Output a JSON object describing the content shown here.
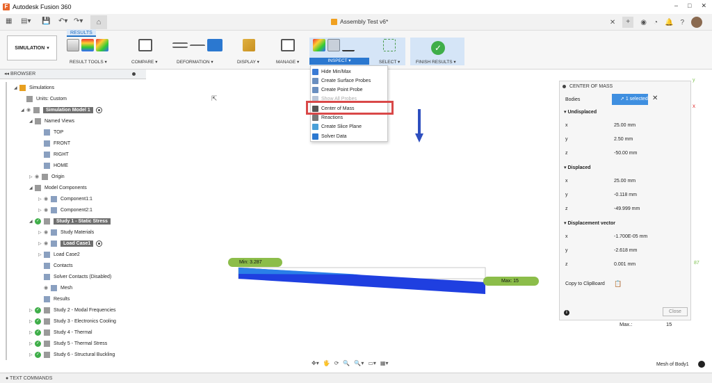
{
  "app": {
    "title": "Autodesk Fusion 360",
    "logo_letter": "F",
    "document_title": "Assembly Test v6*",
    "win_controls": [
      "–",
      "□",
      "✕"
    ]
  },
  "quick_access": {
    "grid_icon": "▦",
    "file_icon": "▤▾",
    "save_icon": "💾",
    "undo_icon": "↶▾",
    "redo_icon": "↷▾",
    "home_icon": "⌂",
    "doc_close": "✕",
    "new_tab": "+",
    "right_icons": [
      "◉",
      "◔",
      "🔔",
      "?"
    ]
  },
  "ribbon": {
    "active_tab": "RESULTS",
    "workspace": "SIMULATION",
    "groups": {
      "result_tools": "RESULT TOOLS ▾",
      "compare": "COMPARE ▾",
      "deformation": "DEFORMATION ▾",
      "display": "DISPLAY ▾",
      "manage": "MANAGE ▾",
      "inspect": "INSPECT ▾",
      "select": "SELECT ▾",
      "finish": "FINISH RESULTS ▾"
    },
    "finish_check": "✓"
  },
  "inspect_menu": [
    {
      "label": "Hide Min/Max",
      "enabled": true,
      "icon": "minmax-icon",
      "color": "#3a7bd5"
    },
    {
      "label": "Create Surface Probes",
      "enabled": true,
      "icon": "surface-probe-icon",
      "color": "#6a8fc0"
    },
    {
      "label": "Create Point Probe",
      "enabled": true,
      "icon": "point-probe-icon",
      "color": "#6a8fc0"
    },
    {
      "label": "Show All Probes",
      "enabled": false,
      "icon": "probes-icon",
      "color": "#b9c6d8"
    },
    {
      "label": "Center of Mass",
      "enabled": true,
      "icon": "center-of-mass-icon",
      "color": "#555555"
    },
    {
      "label": "Reactions",
      "enabled": true,
      "icon": "reactions-icon",
      "color": "#777777"
    },
    {
      "label": "Create Slice Plane",
      "enabled": true,
      "icon": "slice-plane-icon",
      "color": "#4aa0d8"
    },
    {
      "label": "Solver Data",
      "enabled": true,
      "icon": "info-icon",
      "color": "#2b78d0"
    }
  ],
  "browser": {
    "title": "BROWSER",
    "collapse": "◂◂",
    "items": [
      {
        "label": "Simulations",
        "depth": 0,
        "arrow": "◢",
        "name": "tree-simulations"
      },
      {
        "label": "Units: Custom",
        "depth": 1,
        "arrow": "",
        "name": "tree-units"
      },
      {
        "label": "Simulation Model 1",
        "depth": 1,
        "arrow": "◢",
        "name": "tree-simulation-model",
        "highlight": true,
        "target": true,
        "eye": true
      },
      {
        "label": "Named Views",
        "depth": 2,
        "arrow": "◢",
        "name": "tree-named-views"
      },
      {
        "label": "TOP",
        "depth": 3,
        "arrow": "",
        "name": "tree-view-top"
      },
      {
        "label": "FRONT",
        "depth": 3,
        "arrow": "",
        "name": "tree-view-front"
      },
      {
        "label": "RIGHT",
        "depth": 3,
        "arrow": "",
        "name": "tree-view-right"
      },
      {
        "label": "HOME",
        "depth": 3,
        "arrow": "",
        "name": "tree-view-home"
      },
      {
        "label": "Origin",
        "depth": 2,
        "arrow": "▷",
        "name": "tree-origin",
        "eye": true
      },
      {
        "label": "Model Components",
        "depth": 2,
        "arrow": "◢",
        "name": "tree-model-components"
      },
      {
        "label": "Component1:1",
        "depth": 3,
        "arrow": "▷",
        "name": "tree-component1",
        "eye": true
      },
      {
        "label": "Component2:1",
        "depth": 3,
        "arrow": "▷",
        "name": "tree-component2",
        "eye": true
      },
      {
        "label": "Study 1 - Static Stress",
        "depth": 2,
        "arrow": "◢",
        "name": "tree-study1",
        "highlight": true,
        "check": true
      },
      {
        "label": "Study Materials",
        "depth": 3,
        "arrow": "▷",
        "name": "tree-study-materials",
        "eye": true
      },
      {
        "label": "Load Case1",
        "depth": 3,
        "arrow": "▷",
        "name": "tree-load-case1",
        "highlight": true,
        "target": true,
        "eye": true
      },
      {
        "label": "Load Case2",
        "depth": 3,
        "arrow": "▷",
        "name": "tree-load-case2"
      },
      {
        "label": "Contacts",
        "depth": 3,
        "arrow": "",
        "name": "tree-contacts"
      },
      {
        "label": "Solver Contacts (Disabled)",
        "depth": 3,
        "arrow": "",
        "name": "tree-solver-contacts"
      },
      {
        "label": "Mesh",
        "depth": 3,
        "arrow": "",
        "name": "tree-mesh",
        "eye": true
      },
      {
        "label": "Results",
        "depth": 3,
        "arrow": "",
        "name": "tree-results"
      },
      {
        "label": "Study 2 - Modal Frequencies",
        "depth": 2,
        "arrow": "▷",
        "name": "tree-study2",
        "check": true
      },
      {
        "label": "Study 3 - Electronics Cooling",
        "depth": 2,
        "arrow": "▷",
        "name": "tree-study3",
        "check": true
      },
      {
        "label": "Study 4 - Thermal",
        "depth": 2,
        "arrow": "▷",
        "name": "tree-study4",
        "check": true
      },
      {
        "label": "Study 5 - Thermal Stress",
        "depth": 2,
        "arrow": "▷",
        "name": "tree-study5",
        "check": true
      },
      {
        "label": "Study 6 - Structural Buckling",
        "depth": 2,
        "arrow": "▷",
        "name": "tree-study6",
        "check": true
      }
    ]
  },
  "viewport": {
    "min_label": "Min: 3.287",
    "max_label": "Max: 15",
    "max_caption": "Max.:",
    "max_value": "15",
    "mesh_label": "Mesh of Body1",
    "axis_x": "x",
    "axis_y": "y",
    "axis_tick": "87",
    "nav_icons": [
      "✥▾",
      "🖐",
      "⟳",
      "🔍",
      "🔍▾",
      "▭▾",
      "▦▾"
    ]
  },
  "center_of_mass": {
    "title": "CENTER OF MASS",
    "bodies_label": "Bodies",
    "selected_label": "1 selected",
    "clear": "✕",
    "sections": [
      {
        "title": "Undisplaced",
        "rows": [
          [
            "x",
            "25.00 mm"
          ],
          [
            "y",
            "2.50 mm"
          ],
          [
            "z",
            "-50.00 mm"
          ]
        ]
      },
      {
        "title": "Displaced",
        "rows": [
          [
            "x",
            "25.00 mm"
          ],
          [
            "y",
            "-0.118 mm"
          ],
          [
            "z",
            "-49.999 mm"
          ]
        ]
      },
      {
        "title": "Displacement vector",
        "rows": [
          [
            "x",
            "-1.700E-05 mm"
          ],
          [
            "y",
            "-2.618 mm"
          ],
          [
            "z",
            "0.001 mm"
          ]
        ]
      }
    ],
    "copy_label": "Copy to ClipBoard",
    "close_label": "Close"
  },
  "text_commands": "TEXT COMMANDS"
}
